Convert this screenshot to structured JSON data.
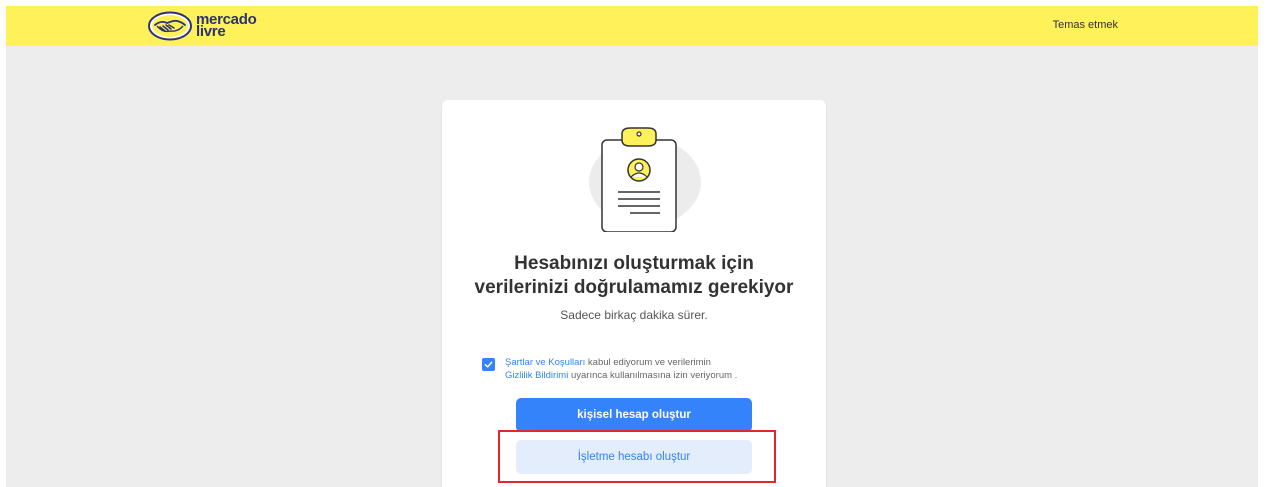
{
  "header": {
    "logo_line1": "mercado",
    "logo_line2": "livre",
    "contact_label": "Temas etmek",
    "bg_color": "#fff159"
  },
  "card": {
    "title_line1": "Hesabınızı oluşturmak için",
    "title_line2": "verilerinizi doğrulamamız gerekiyor",
    "subtitle": "Sadece birkaç dakika sürer.",
    "consent": {
      "checked": true,
      "terms_link": "Şartlar ve Koşulları",
      "text_part1": " kabul ediyorum ve verilerimin",
      "privacy_link": "Gizlilik Bildirimi",
      "text_part2": " uyarınca kullanılmasına izin veriyorum ."
    },
    "primary_button": "kişisel hesap oluştur",
    "secondary_button": "İşletme hesabı oluştur"
  },
  "colors": {
    "accent": "#3483fa",
    "highlight": "#e0282b",
    "illustration_yellow": "#fff159"
  },
  "icons": {
    "logo": "handshake-icon",
    "illustration": "clipboard-user-icon",
    "checkbox": "checkmark-icon"
  }
}
